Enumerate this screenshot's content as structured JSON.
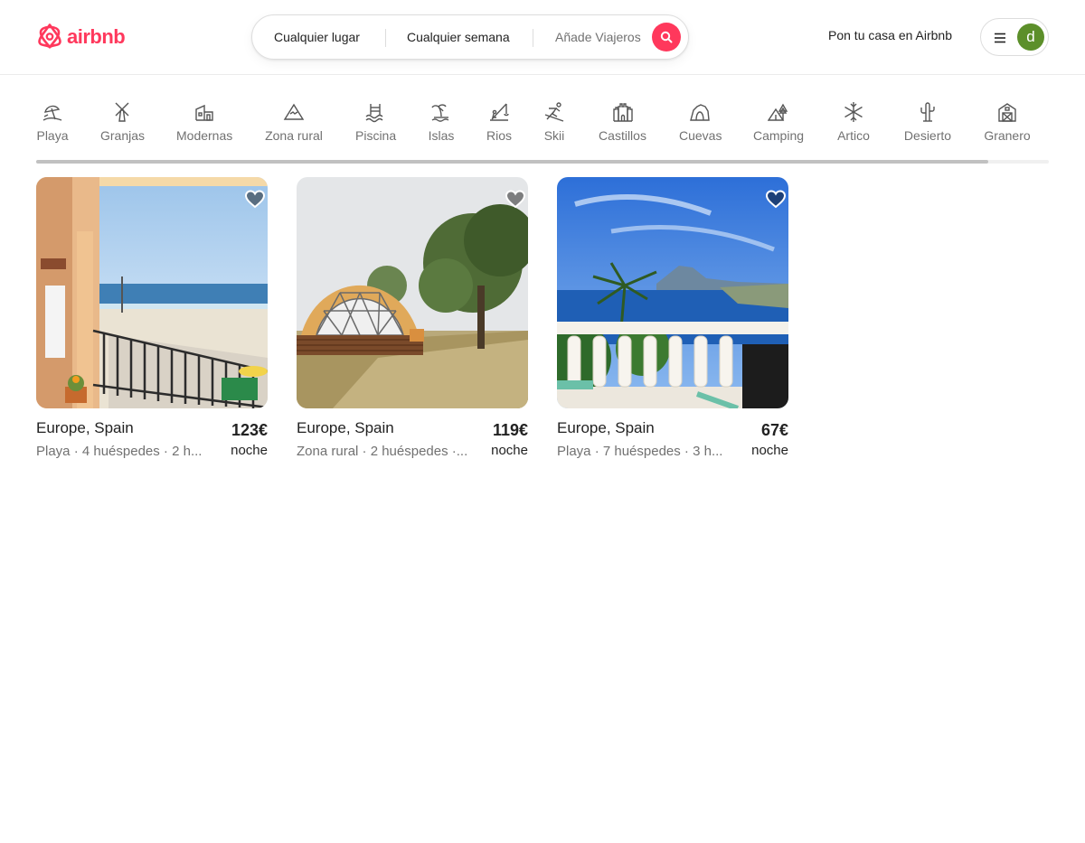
{
  "brand": {
    "logo_text": "airbnb",
    "accent": "#ff385c"
  },
  "search": {
    "place": "Cualquier lugar",
    "week": "Cualquier semana",
    "guests": "Añade Viajeros",
    "button_icon": "search-icon"
  },
  "header": {
    "host_link": "Pon tu casa en Airbnb",
    "menu_icon": "hamburger-icon",
    "avatar_initial": "d",
    "avatar_color": "#5c8f2a"
  },
  "categories": [
    {
      "label": "Playa",
      "icon": "beach-icon"
    },
    {
      "label": "Granjas",
      "icon": "windmill-icon"
    },
    {
      "label": "Modernas",
      "icon": "modern-house-icon"
    },
    {
      "label": "Zona rural",
      "icon": "mountain-icon"
    },
    {
      "label": "Piscina",
      "icon": "pool-icon"
    },
    {
      "label": "Islas",
      "icon": "island-icon"
    },
    {
      "label": "Rios",
      "icon": "fishing-icon"
    },
    {
      "label": "Skii",
      "icon": "ski-icon"
    },
    {
      "label": "Castillos",
      "icon": "castle-icon"
    },
    {
      "label": "Cuevas",
      "icon": "cave-icon"
    },
    {
      "label": "Camping",
      "icon": "tent-icon"
    },
    {
      "label": "Artico",
      "icon": "snowflake-icon"
    },
    {
      "label": "Desierto",
      "icon": "cactus-icon"
    },
    {
      "label": "Granero",
      "icon": "barn-icon"
    }
  ],
  "categories_scroll_fraction": 0.94,
  "listings": [
    {
      "location": "Europe, Spain",
      "description": "Playa · 4 huéspedes · 2 h...",
      "price": "123€",
      "unit": "noche",
      "photo": "balcony-beach-view"
    },
    {
      "location": "Europe, Spain",
      "description": "Zona rural · 2 huéspedes ·...",
      "price": "119€",
      "unit": "noche",
      "photo": "geodesic-dome-countryside"
    },
    {
      "location": "Europe, Spain",
      "description": "Playa · 7 huéspedes · 3 h...",
      "price": "67€",
      "unit": "noche",
      "photo": "terrace-sea-view"
    }
  ]
}
